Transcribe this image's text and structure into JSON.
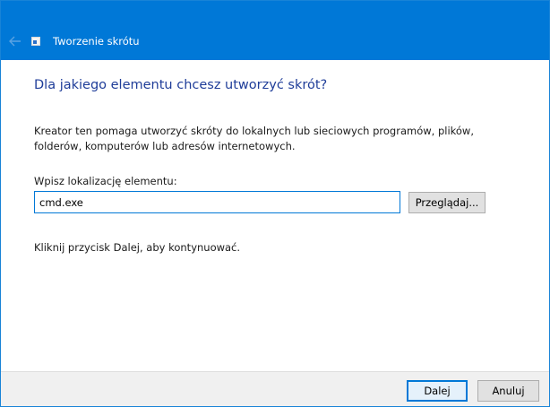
{
  "window": {
    "title": "Tworzenie skrótu",
    "title_color": "#0078d7"
  },
  "titlebar": {
    "back_icon": "arrow-left-icon",
    "app_icon": "shortcut-icon"
  },
  "wizard": {
    "heading": "Dla jakiego elementu chcesz utworzyć skrót?",
    "description": "Kreator ten pomaga utworzyć skróty do lokalnych lub sieciowych programów, plików, folderów, komputerów lub adresów internetowych.",
    "location_label": "Wpisz lokalizację elementu:",
    "location_value": "cmd.exe",
    "browse_label": "Przeglądaj...",
    "hint": "Kliknij przycisk Dalej, aby kontynuować."
  },
  "footer": {
    "next_label": "Dalej",
    "cancel_label": "Anuluj"
  }
}
